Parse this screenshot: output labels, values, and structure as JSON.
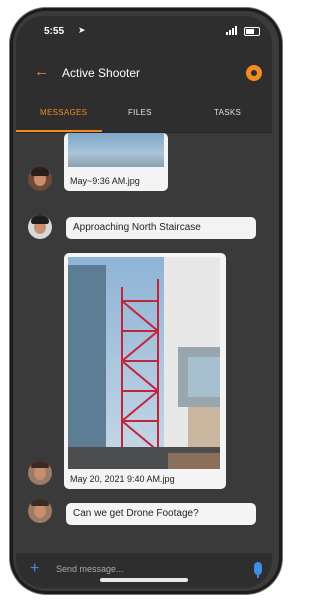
{
  "status_bar": {
    "time": "5:55"
  },
  "header": {
    "back_glyph": "←",
    "title": "Active Shooter",
    "hazard_icon": "hazard-icon"
  },
  "tabs": [
    {
      "label": "MESSAGES",
      "active": true
    },
    {
      "label": "FILES",
      "active": false
    },
    {
      "label": "TASKS",
      "active": false
    }
  ],
  "messages": [
    {
      "type": "image",
      "caption": "May~9:36 AM.jpg"
    },
    {
      "type": "text",
      "text": "Approaching North Staircase"
    },
    {
      "type": "image",
      "caption": "May 20, 2021 9:40 AM.jpg"
    },
    {
      "type": "text",
      "text": "Can we get Drone Footage?"
    }
  ],
  "composer": {
    "placeholder": "Send message...",
    "plus_glyph": "+"
  },
  "colors": {
    "accent": "#f28c1e",
    "link": "#3d8ee8",
    "background": "#3a3a3a"
  }
}
